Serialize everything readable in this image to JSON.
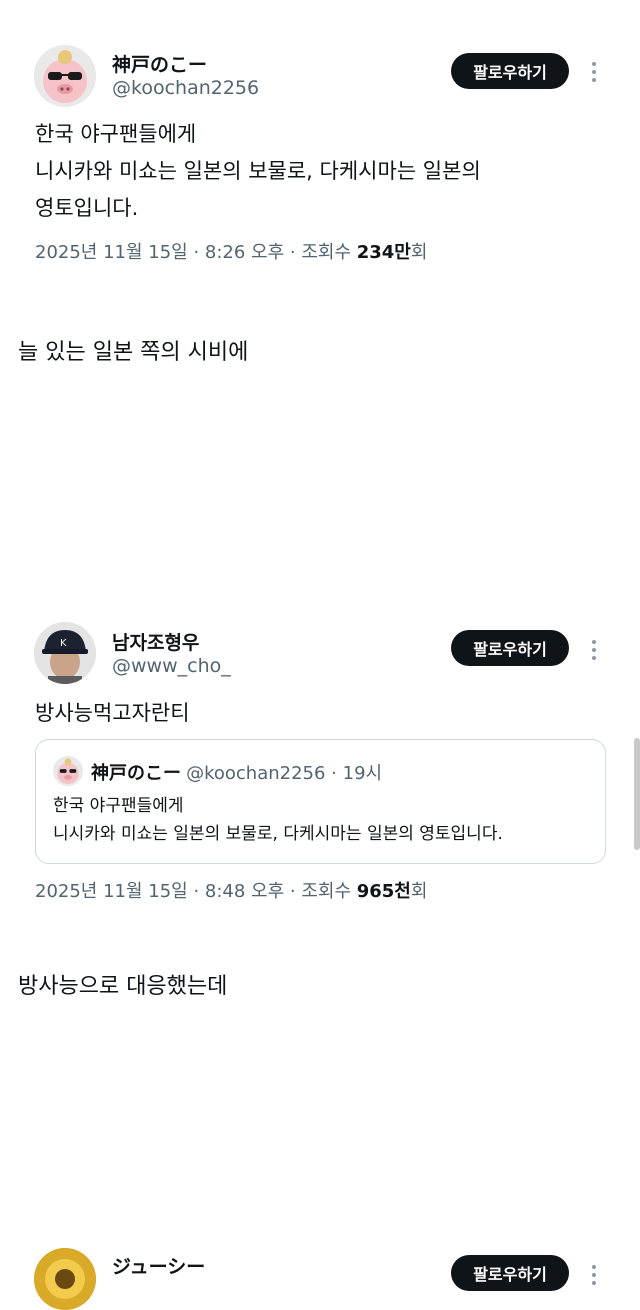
{
  "tweets": [
    {
      "name": "神戸のこー",
      "handle": "@koochan2256",
      "follow_label": "팔로우하기",
      "text_lines": [
        "한국 야구팬들에게",
        "니시카와 미쇼는 일본의 보물로, 다케시마는 일본의",
        "영토입니다."
      ],
      "meta_prefix": "2025년 11월 15일 · 8:26 오후 · 조회수 ",
      "views": "234만",
      "views_suffix": "회",
      "avatar_icon": "pig-with-sunglasses-avatar"
    },
    {
      "name": "남자조형우",
      "handle": "@www_cho_",
      "follow_label": "팔로우하기",
      "text_lines": [
        "방사능먹고자란티"
      ],
      "quote": {
        "name": "神戸のこー",
        "handle_time": "@koochan2256 · 19시",
        "text_lines": [
          "한국 야구팬들에게",
          "니시카와 미쇼는 일본의 보물로, 다케시마는 일본의 영토입니다."
        ]
      },
      "meta_prefix": "2025년 11월 15일 · 8:48 오후 · 조회수 ",
      "views": "965천",
      "views_suffix": "회",
      "avatar_icon": "person-in-cap-avatar"
    },
    {
      "name": "ジューシー",
      "follow_label": "팔로우하기",
      "avatar_icon": "golden-avatar"
    }
  ],
  "captions": [
    "늘 있는 일본 쪽의 시비에",
    "방사능으로 대응했는데"
  ],
  "colors": {
    "follow_bg": "#0f1419",
    "secondary_text": "#536471",
    "border": "#cfd9de"
  }
}
